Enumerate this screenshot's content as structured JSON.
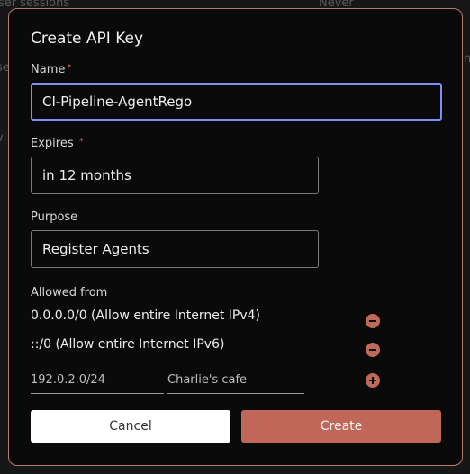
{
  "background": {
    "texts": [
      "ser sessions",
      "Never",
      "se",
      "n",
      "vi"
    ]
  },
  "modal": {
    "title": "Create API Key",
    "name_label": "Name",
    "name_required": "*",
    "name_value": "CI-Pipeline-AgentRego",
    "expires_label": "Expires",
    "expires_required": "*",
    "expires_value": "in 12 months",
    "purpose_label": "Purpose",
    "purpose_value": "Register Agents",
    "allowed_label": "Allowed from",
    "allowed_entries": [
      "0.0.0.0/0 (Allow entire Internet IPv4)",
      "::/0 (Allow entire Internet IPv6)"
    ],
    "new_entry": {
      "cidr_placeholder": "192.0.2.0/24",
      "description_placeholder": "Charlie's cafe"
    },
    "cancel_label": "Cancel",
    "create_label": "Create"
  },
  "colors": {
    "accent": "#c0675a",
    "focus": "#7f8ff0",
    "modal_border": "#b97a6a"
  }
}
